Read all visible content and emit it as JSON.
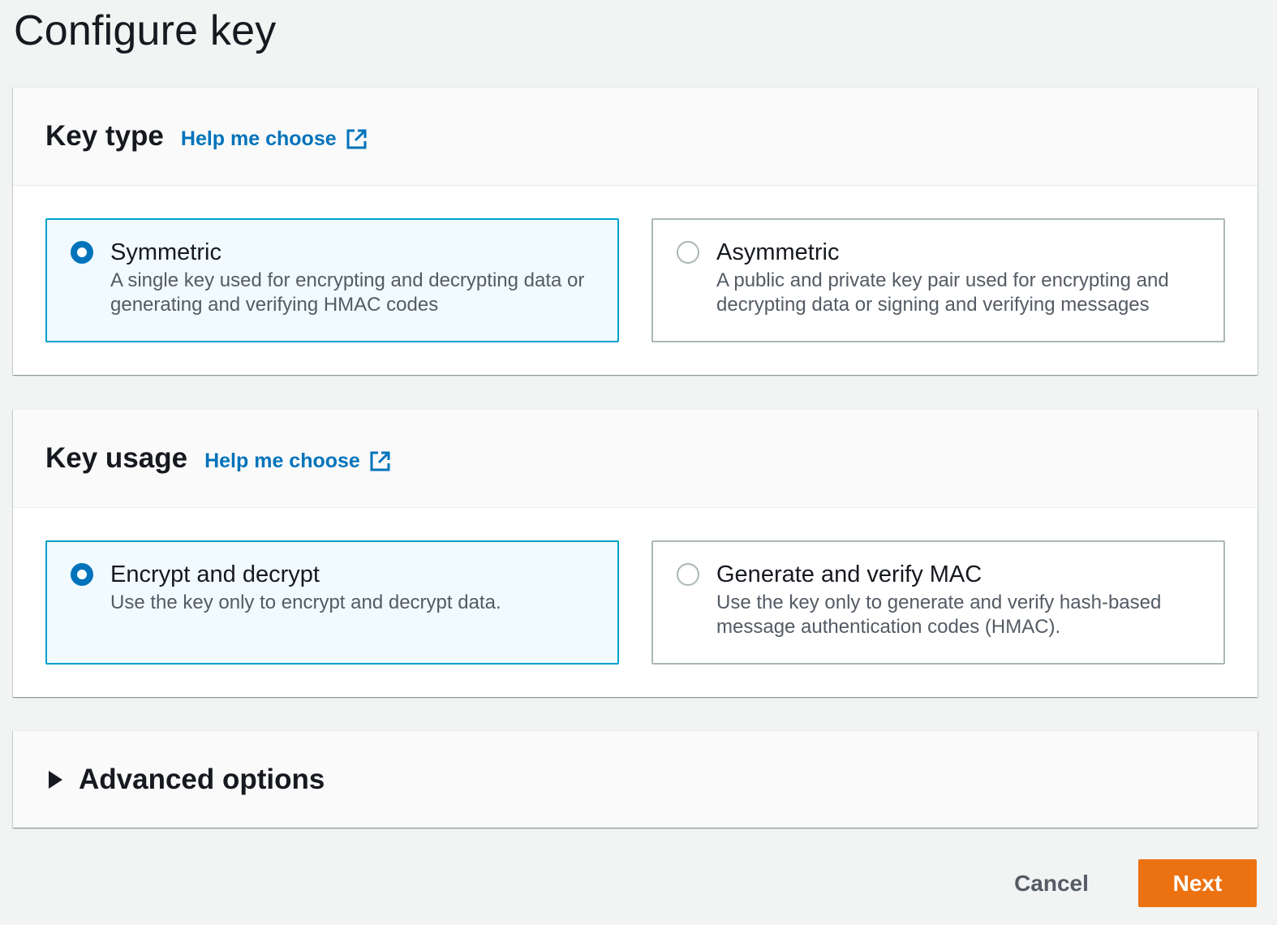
{
  "page": {
    "title": "Configure key"
  },
  "key_type": {
    "title": "Key type",
    "help_link": "Help me choose",
    "options": [
      {
        "label": "Symmetric",
        "description": "A single key used for encrypting and decrypting data or generating and verifying HMAC codes",
        "selected": true
      },
      {
        "label": "Asymmetric",
        "description": "A public and private key pair used for encrypting and decrypting data or signing and verifying messages",
        "selected": false
      }
    ]
  },
  "key_usage": {
    "title": "Key usage",
    "help_link": "Help me choose",
    "options": [
      {
        "label": "Encrypt and decrypt",
        "description": "Use the key only to encrypt and decrypt data.",
        "selected": true
      },
      {
        "label": "Generate and verify MAC",
        "description": "Use the key only to generate and verify hash-based message authentication codes (HMAC).",
        "selected": false
      }
    ]
  },
  "advanced": {
    "label": "Advanced options",
    "expanded": false,
    "icon": "caret-right-icon"
  },
  "footer": {
    "cancel_label": "Cancel",
    "next_label": "Next"
  },
  "colors": {
    "primary_button": "#ec7211",
    "link": "#0073bb",
    "selected_border": "#00a1c9",
    "selected_bg": "#f1faff",
    "radio_checked": "#0073bb"
  }
}
